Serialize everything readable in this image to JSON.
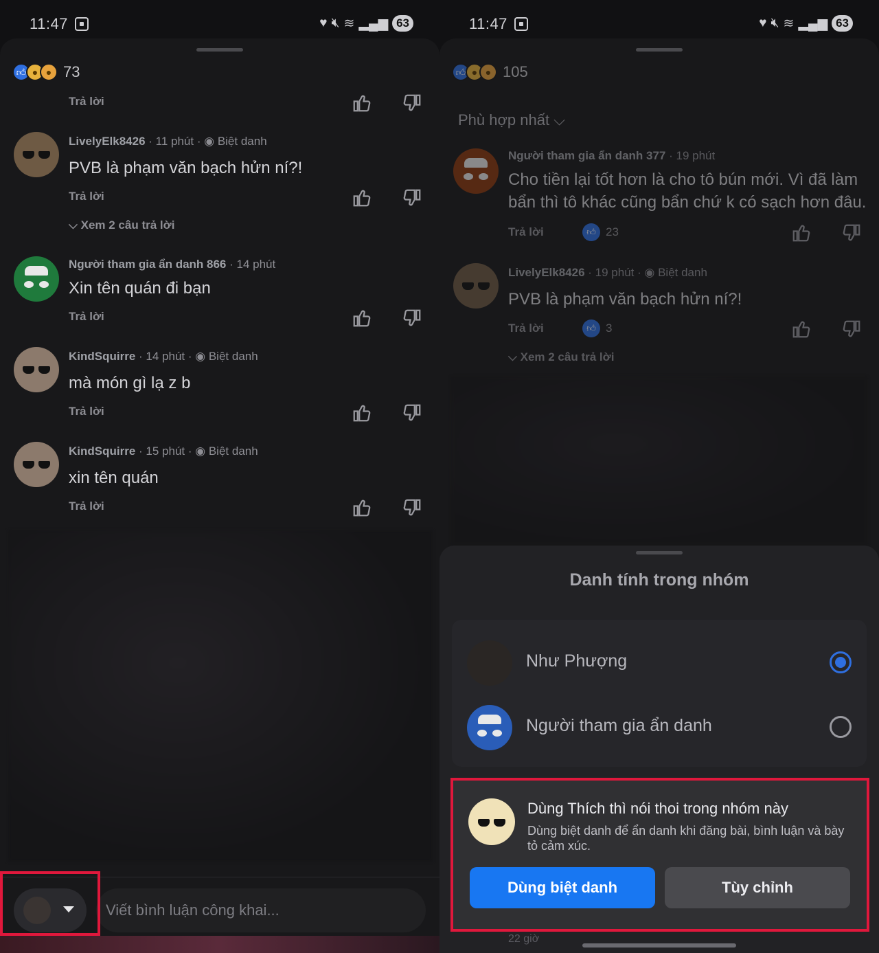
{
  "status": {
    "time": "11:47",
    "battery": "63"
  },
  "left": {
    "reaction_count": "73",
    "top_reply": "Trả lời",
    "comments": [
      {
        "author": "LivelyElk8426",
        "time": "· 11 phút ·",
        "badge": "Biệt danh",
        "text": "PVB là phạm văn bạch hửn ní?!",
        "reply": "Trả lời",
        "view_more": "Xem 2 câu trả lời"
      },
      {
        "author": "Người tham gia ẩn danh 866",
        "time": "· 14 phút",
        "badge": "",
        "text": "Xin tên quán đi bạn",
        "reply": "Trả lời"
      },
      {
        "author": "KindSquirre",
        "time": "· 14 phút ·",
        "badge": "Biệt danh",
        "text": "mà món gì lạ z b",
        "reply": "Trả lời"
      },
      {
        "author": "KindSquirre",
        "time": "· 15 phút ·",
        "badge": "Biệt danh",
        "text": "xin tên quán",
        "reply": "Trả lời"
      }
    ],
    "composer_placeholder": "Viết bình luận công khai..."
  },
  "right": {
    "reaction_count": "105",
    "sort_label": "Phù hợp nhất",
    "comments": [
      {
        "author": "Người tham gia ẩn danh 377",
        "time": "· 19 phút",
        "badge": "",
        "text_line1": "Cho tiền lại tốt hơn là cho tô bún mới. Vì đã làm",
        "text_line2": "bẩn thì tô khác cũng bẩn chứ k có sạch hơn đâu.",
        "reply": "Trả lời",
        "likes": "23"
      },
      {
        "author": "LivelyElk8426",
        "time": "· 19 phút ·",
        "badge": "Biệt danh",
        "text": "PVB là phạm văn bạch hửn ní?!",
        "reply": "Trả lời",
        "likes": "3",
        "view_more": "Xem 2 câu trả lời"
      }
    ],
    "modal": {
      "title": "Danh tính trong nhóm",
      "options": [
        {
          "name": "Như Phượng",
          "selected": true
        },
        {
          "name": "Người tham gia ẩn danh",
          "selected": false
        }
      ],
      "nickname_card": {
        "title": "Dùng Thích thì nói thoi trong nhóm này",
        "description": "Dùng biệt danh để ẩn danh khi đăng bài, bình luận và bày tỏ cảm xúc.",
        "primary_button": "Dùng biệt danh",
        "secondary_button": "Tùy chỉnh"
      },
      "footer_time": "22 giờ"
    }
  },
  "colors": {
    "accent": "#1877f2",
    "highlight": "#e0183c",
    "background": "#18181a"
  }
}
